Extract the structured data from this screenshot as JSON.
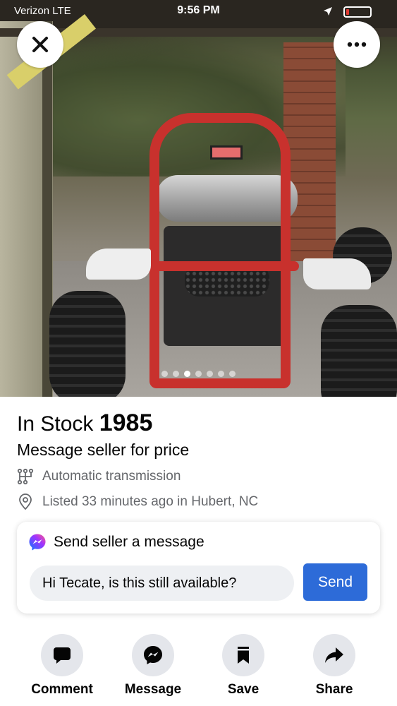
{
  "status_bar": {
    "carrier": "Verizon LTE",
    "time": "9:56 PM",
    "battery_level": 0.14
  },
  "photo": {
    "image_count": 7,
    "active_index": 2
  },
  "listing": {
    "title_prefix": "In Stock",
    "title_year": "1985",
    "price_text": "Message seller for price",
    "transmission": "Automatic transmission",
    "listed": "Listed 33 minutes ago in Hubert, NC"
  },
  "message_card": {
    "header": "Send seller a message",
    "input_value": "Hi Tecate, is this still available?",
    "send_label": "Send"
  },
  "actions": {
    "comment": "Comment",
    "message": "Message",
    "save": "Save",
    "share": "Share"
  },
  "colors": {
    "accent": "#2d6bd8",
    "icon_circle_bg": "#e4e6eb",
    "secondary_text": "#65676b",
    "battery_low": "#e23b33"
  }
}
